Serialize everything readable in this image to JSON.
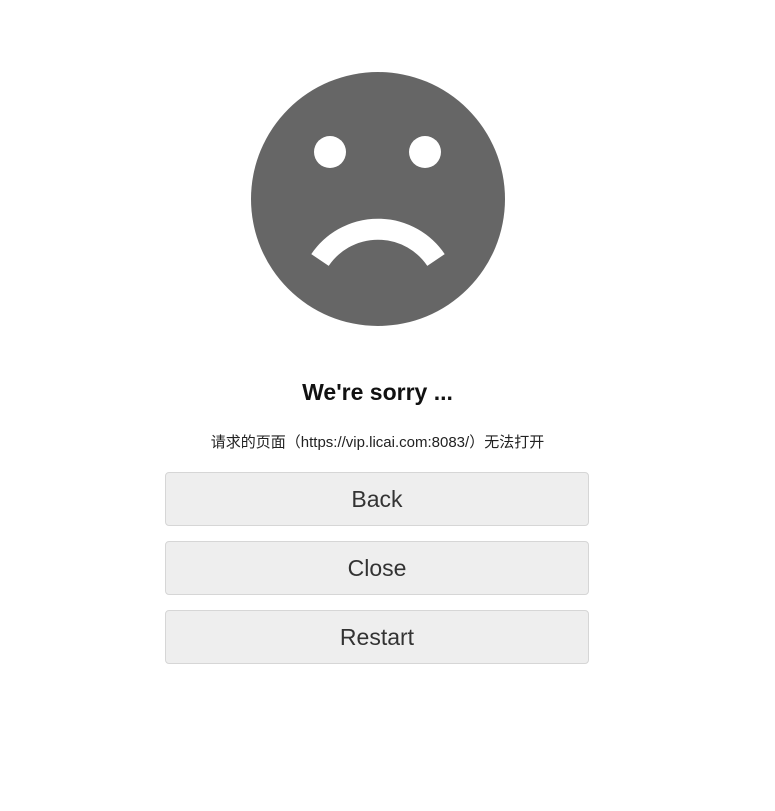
{
  "error_page": {
    "icon": "sad-face-icon",
    "title": "We're sorry ...",
    "message": "请求的页面（https://vip.licai.com:8083/）无法打开"
  },
  "buttons": {
    "back": "Back",
    "close": "Close",
    "restart": "Restart"
  },
  "colors": {
    "icon": "#666666",
    "button_background": "#eeeeee",
    "button_border": "#d6d6d6",
    "button_text": "#333333",
    "title_text": "#111111"
  }
}
